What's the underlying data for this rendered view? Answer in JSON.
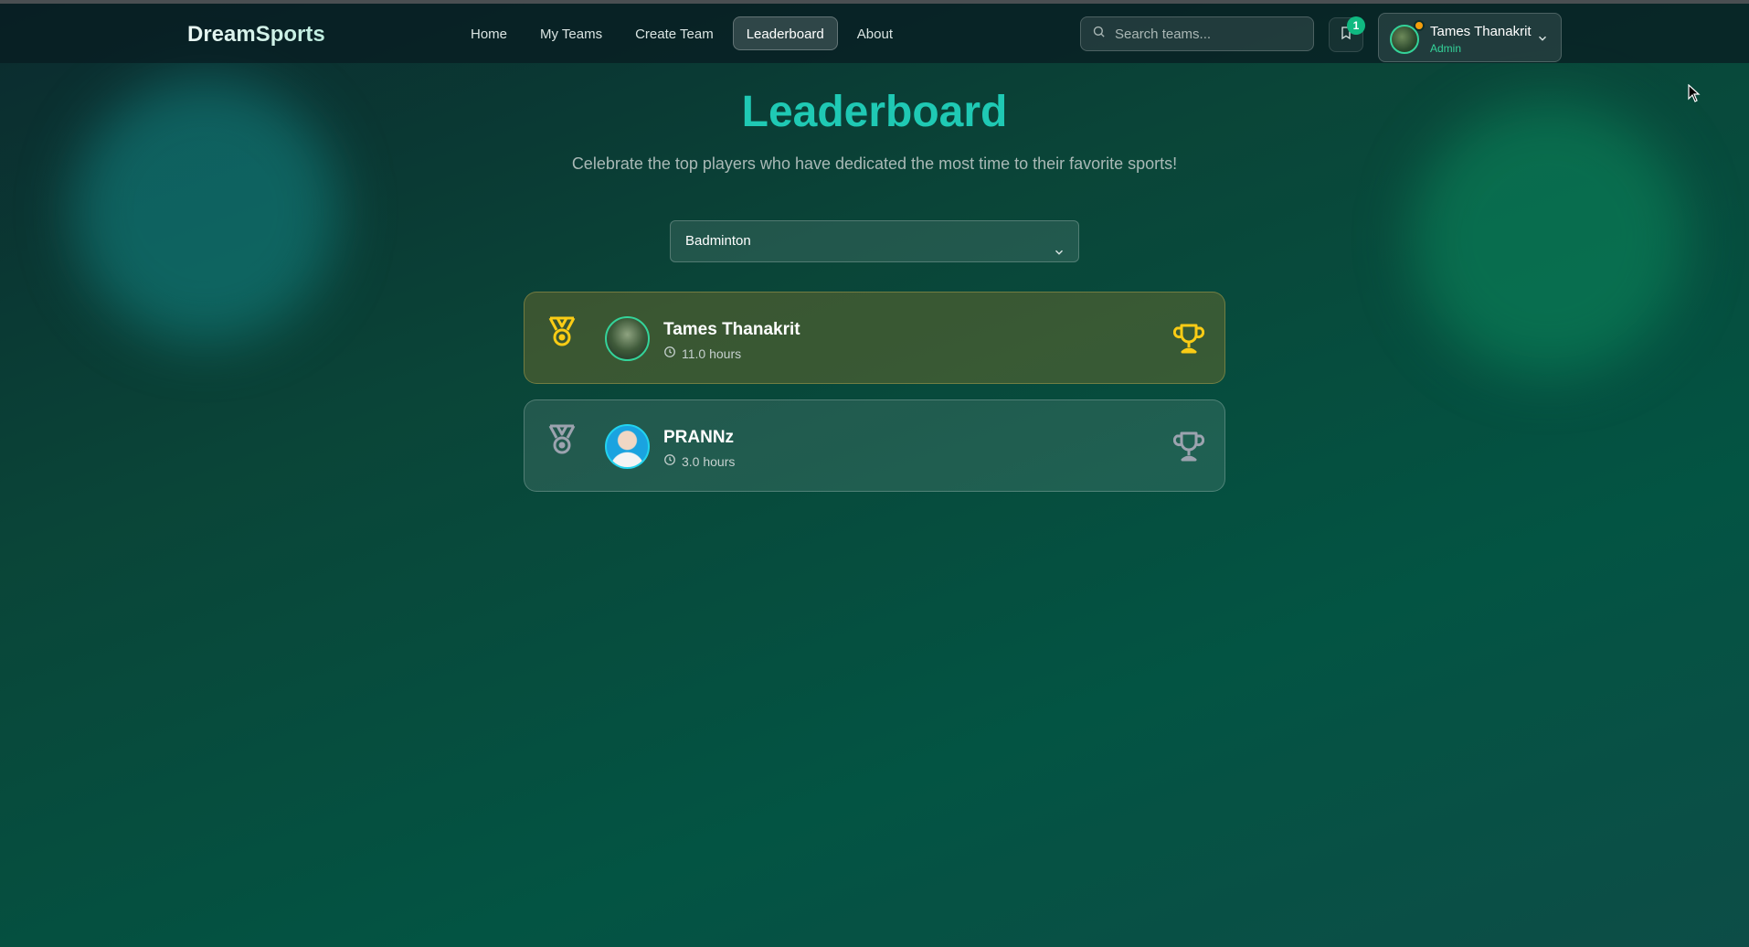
{
  "nav": {
    "brand": "DreamSports",
    "links": [
      {
        "label": "Home"
      },
      {
        "label": "My Teams"
      },
      {
        "label": "Create Team"
      },
      {
        "label": "Leaderboard",
        "active": true
      },
      {
        "label": "About"
      }
    ],
    "search_placeholder": "Search teams...",
    "notification_count": "1",
    "user": {
      "name": "Tames Thanakrit",
      "role": "Admin"
    }
  },
  "page": {
    "title": "Leaderboard",
    "subtitle": "Celebrate the top players who have dedicated the most time to their favorite sports!",
    "sport_select": "Badminton"
  },
  "leaderboard": [
    {
      "name": "Tames Thanakrit",
      "hours": "11.0 hours",
      "medal": "gold"
    },
    {
      "name": "PRANNz",
      "hours": "3.0 hours",
      "medal": "silver"
    }
  ],
  "colors": {
    "accent": "#1fc9b4",
    "gold": "#facc15",
    "silver": "#9ca3af",
    "badge": "#10b981"
  }
}
